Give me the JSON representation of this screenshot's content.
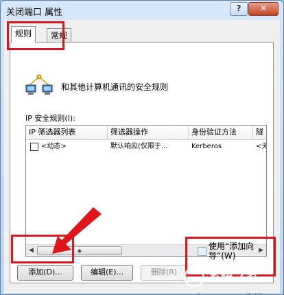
{
  "window": {
    "title": "关闭端口 属性",
    "help_label": "?",
    "close_label": "✕"
  },
  "tabs": [
    {
      "label": "规则",
      "active": true
    },
    {
      "label": "常规",
      "active": false
    }
  ],
  "header": {
    "icon": "network-computers-icon",
    "description": "和其他计算机通讯的安全规则"
  },
  "rules_list": {
    "label": "IP 安全规则(I):",
    "columns": [
      "IP 筛选器列表",
      "筛选器操作",
      "身份验证方法",
      "隧"
    ],
    "rows": [
      {
        "checked": false,
        "cells": [
          "<动态>",
          "默认响应(仅限于...",
          "Kerberos",
          "<无"
        ]
      }
    ],
    "scroll_left": "◀",
    "scroll_right": "▶",
    "scroll_thumb": "◆"
  },
  "buttons": {
    "add": "添加(D)...",
    "edit": "编辑(E)...",
    "remove": "删除(R)"
  },
  "wizard": {
    "line1": "使用“添加向",
    "line2": "导”(W)",
    "checked": false
  },
  "bottom": {
    "frag_left": "定",
    "frag_right": "取消"
  },
  "watermark": "系统之家",
  "colors": {
    "highlight": "#e0141b",
    "close_button": "#c74325"
  }
}
